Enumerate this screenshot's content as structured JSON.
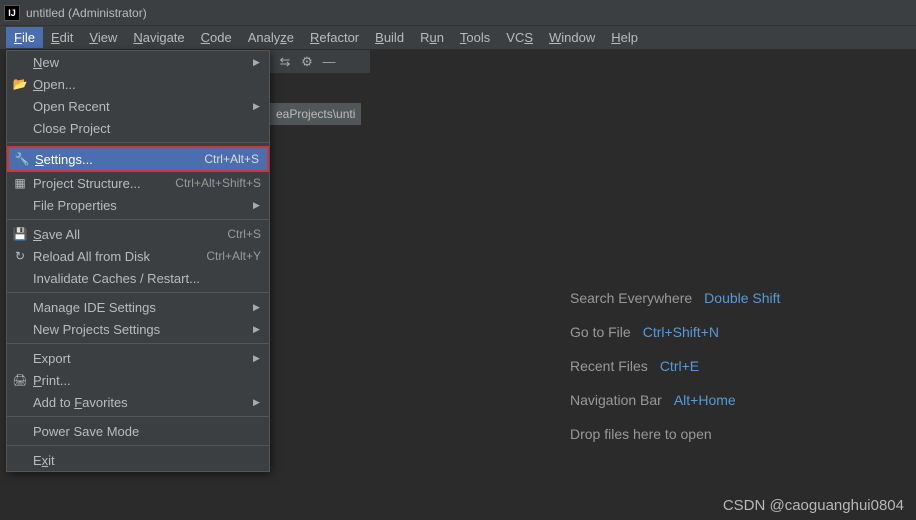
{
  "title": "untitled (Administrator)",
  "menubar": [
    "File",
    "Edit",
    "View",
    "Navigate",
    "Code",
    "Analyze",
    "Refactor",
    "Build",
    "Run",
    "Tools",
    "VCS",
    "Window",
    "Help"
  ],
  "fileMenu": {
    "new": "New",
    "open": "Open...",
    "openRecent": "Open Recent",
    "closeProject": "Close Project",
    "settings": "Settings...",
    "settingsKey": "Ctrl+Alt+S",
    "projectStructure": "Project Structure...",
    "projectStructureKey": "Ctrl+Alt+Shift+S",
    "fileProperties": "File Properties",
    "saveAll": "Save All",
    "saveAllKey": "Ctrl+S",
    "reload": "Reload All from Disk",
    "reloadKey": "Ctrl+Alt+Y",
    "invalidate": "Invalidate Caches / Restart...",
    "manageIDE": "Manage IDE Settings",
    "newProjects": "New Projects Settings",
    "export": "Export",
    "print": "Print...",
    "addFav": "Add to Favorites",
    "powerSave": "Power Save Mode",
    "exit": "Exit"
  },
  "tabFragment": "eaProjects\\unti",
  "welcome": {
    "searchLabel": "Search Everywhere",
    "searchKey": "Double Shift",
    "gotoLabel": "Go to File",
    "gotoKey": "Ctrl+Shift+N",
    "recentLabel": "Recent Files",
    "recentKey": "Ctrl+E",
    "navLabel": "Navigation Bar",
    "navKey": "Alt+Home",
    "dropLabel": "Drop files here to open"
  },
  "watermark": "CSDN @caoguanghui0804"
}
